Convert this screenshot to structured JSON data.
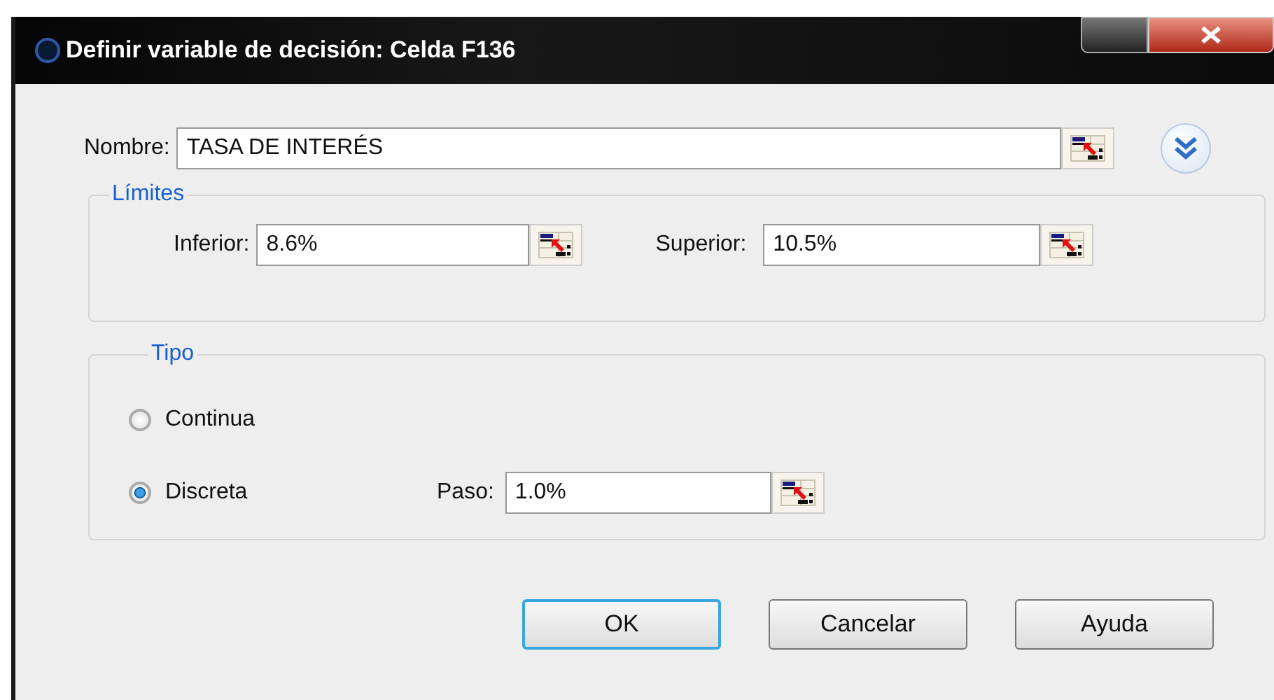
{
  "window": {
    "title": "Definir variable de decisión: Celda F136"
  },
  "name_field": {
    "label": "Nombre:",
    "value": "TASA DE INTERÉS"
  },
  "limits": {
    "title": "Límites",
    "lower": {
      "label": "Inferior:",
      "value": "8.6%"
    },
    "upper": {
      "label": "Superior:",
      "value": "10.5%"
    }
  },
  "type": {
    "title": "Tipo",
    "options": [
      {
        "label": "Continua",
        "selected": false
      },
      {
        "label": "Discreta",
        "selected": true
      }
    ],
    "step": {
      "label": "Paso:",
      "value": "1.0%"
    }
  },
  "buttons": [
    {
      "label": "OK",
      "default": true
    },
    {
      "label": "Cancelar",
      "default": false
    },
    {
      "label": "Ayuda",
      "default": false
    }
  ]
}
